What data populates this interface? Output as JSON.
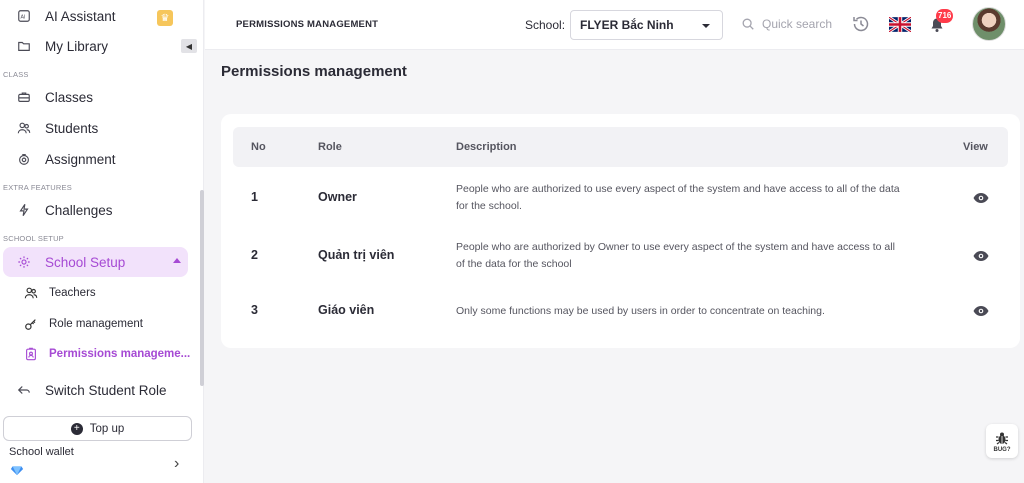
{
  "sidebar": {
    "items_top": [
      {
        "label": "AI Assistant",
        "icon": "ai-icon"
      },
      {
        "label": "My Library",
        "icon": "folder-icon"
      }
    ],
    "section_class": "CLASS",
    "class_items": [
      {
        "label": "Classes",
        "icon": "briefcase-icon"
      },
      {
        "label": "Students",
        "icon": "users-icon"
      },
      {
        "label": "Assignment",
        "icon": "assignment-icon"
      }
    ],
    "section_extra": "EXTRA FEATURES",
    "challenges": "Challenges",
    "section_setup": "SCHOOL SETUP",
    "school_setup": "School Setup",
    "sub_items": [
      {
        "label": "Teachers",
        "icon": "teacher-icon"
      },
      {
        "label": "Role management",
        "icon": "key-icon"
      },
      {
        "label": "Permissions manageme...",
        "icon": "badge-icon"
      }
    ],
    "switch_role": "Switch Student Role",
    "topup": "Top up",
    "wallet": "School wallet",
    "accent": "#a64ad4"
  },
  "header": {
    "title": "PERMISSIONS MANAGEMENT",
    "school_label": "School:",
    "school_value": "FLYER Bắc Ninh",
    "search_placeholder": "Quick search",
    "notification_count": "716"
  },
  "main": {
    "heading": "Permissions management",
    "columns": {
      "no": "No",
      "role": "Role",
      "description": "Description",
      "view": "View"
    },
    "rows": [
      {
        "no": "1",
        "role": "Owner",
        "description": "People who are authorized to use every aspect of the system and have access to all of the data for the school."
      },
      {
        "no": "2",
        "role": "Quản trị viên",
        "description": "People who are authorized by Owner to use every aspect of the system and have access to all of the data for the school"
      },
      {
        "no": "3",
        "role": "Giáo viên",
        "description": "Only some functions may be used by users in order to concentrate on teaching."
      }
    ]
  },
  "bug_label": "BUG?"
}
